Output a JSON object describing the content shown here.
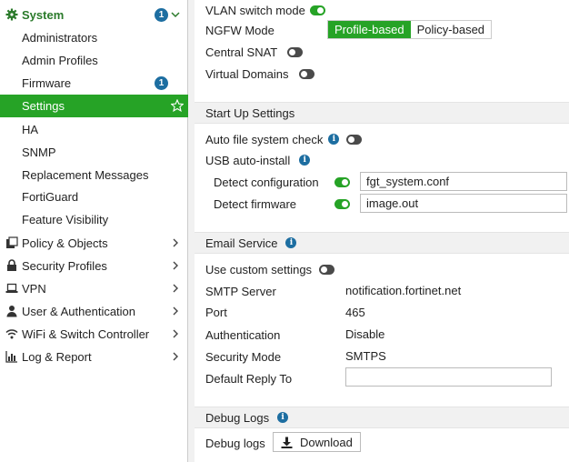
{
  "sidebar": {
    "system": {
      "label": "System",
      "badge": "1"
    },
    "system_items": [
      {
        "label": "Administrators"
      },
      {
        "label": "Admin Profiles"
      },
      {
        "label": "Firmware",
        "badge": "1"
      },
      {
        "label": "Settings"
      },
      {
        "label": "HA"
      },
      {
        "label": "SNMP"
      },
      {
        "label": "Replacement Messages"
      },
      {
        "label": "FortiGuard"
      },
      {
        "label": "Feature Visibility"
      }
    ],
    "categories": [
      {
        "label": "Policy & Objects",
        "icon": "policy-icon"
      },
      {
        "label": "Security Profiles",
        "icon": "lock-icon"
      },
      {
        "label": "VPN",
        "icon": "laptop-icon"
      },
      {
        "label": "User & Authentication",
        "icon": "user-icon"
      },
      {
        "label": "WiFi & Switch Controller",
        "icon": "wifi-icon"
      },
      {
        "label": "Log & Report",
        "icon": "chart-icon"
      }
    ]
  },
  "main": {
    "vlan_switch_mode": {
      "label": "VLAN switch mode",
      "enabled": true
    },
    "ngfw_mode": {
      "label": "NGFW Mode",
      "options": [
        "Profile-based",
        "Policy-based"
      ],
      "selected": "Profile-based"
    },
    "central_snat": {
      "label": "Central SNAT",
      "enabled": false
    },
    "virtual_domains": {
      "label": "Virtual Domains",
      "enabled": false
    },
    "startup": {
      "title": "Start Up Settings",
      "auto_fs_check": {
        "label": "Auto file system check",
        "enabled": false
      },
      "usb_auto_install": {
        "label": "USB auto-install"
      },
      "detect_config": {
        "label": "Detect configuration",
        "enabled": true,
        "value": "fgt_system.conf"
      },
      "detect_firmware": {
        "label": "Detect firmware",
        "enabled": true,
        "value": "image.out"
      }
    },
    "email": {
      "title": "Email Service",
      "use_custom": {
        "label": "Use custom settings",
        "enabled": false
      },
      "smtp_server": {
        "label": "SMTP Server",
        "value": "notification.fortinet.net"
      },
      "port": {
        "label": "Port",
        "value": "465"
      },
      "authentication": {
        "label": "Authentication",
        "value": "Disable"
      },
      "security_mode": {
        "label": "Security Mode",
        "value": "SMTPS"
      },
      "default_reply_to": {
        "label": "Default Reply To",
        "value": ""
      }
    },
    "debug": {
      "title": "Debug Logs",
      "debug_logs": {
        "label": "Debug logs"
      },
      "download_label": "Download"
    }
  },
  "colors": {
    "accent": "#26a326",
    "info": "#1d6ea1",
    "section_bg": "#f1f1f1"
  }
}
